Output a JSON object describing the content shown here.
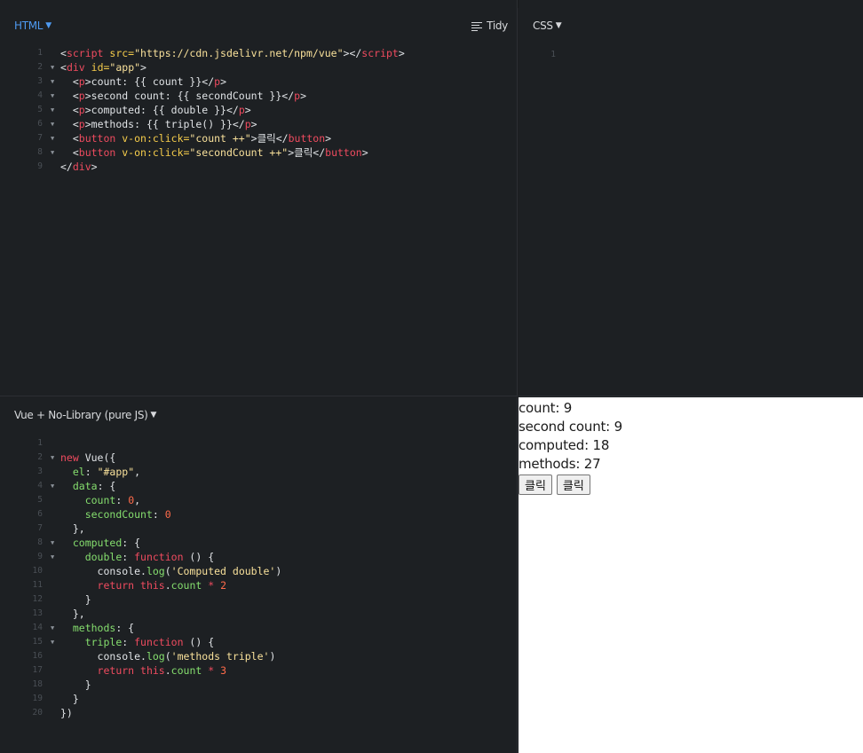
{
  "html_pane": {
    "language": "HTML",
    "tidy_label": "Tidy",
    "lines": [
      {
        "n": "1",
        "fold": false,
        "tokens": [
          {
            "c": "t-plain",
            "t": "<"
          },
          {
            "c": "t-tag",
            "t": "script"
          },
          {
            "c": "t-attr",
            "t": " src="
          },
          {
            "c": "t-str",
            "t": "\"https://cdn.jsdelivr.net/npm/vue\""
          },
          {
            "c": "t-plain",
            "t": "></"
          },
          {
            "c": "t-tag",
            "t": "script"
          },
          {
            "c": "t-plain",
            "t": ">"
          }
        ]
      },
      {
        "n": "2",
        "fold": true,
        "tokens": [
          {
            "c": "t-plain",
            "t": "<"
          },
          {
            "c": "t-tag",
            "t": "div"
          },
          {
            "c": "t-attr",
            "t": " id="
          },
          {
            "c": "t-str",
            "t": "\"app\""
          },
          {
            "c": "t-plain",
            "t": ">"
          }
        ]
      },
      {
        "n": "3",
        "fold": true,
        "tokens": [
          {
            "c": "t-plain",
            "t": "  <"
          },
          {
            "c": "t-tag",
            "t": "p"
          },
          {
            "c": "t-plain",
            "t": ">count: {{ count }}</"
          },
          {
            "c": "t-tag",
            "t": "p"
          },
          {
            "c": "t-plain",
            "t": ">"
          }
        ]
      },
      {
        "n": "4",
        "fold": true,
        "tokens": [
          {
            "c": "t-plain",
            "t": "  <"
          },
          {
            "c": "t-tag",
            "t": "p"
          },
          {
            "c": "t-plain",
            "t": ">second count: {{ secondCount }}</"
          },
          {
            "c": "t-tag",
            "t": "p"
          },
          {
            "c": "t-plain",
            "t": ">"
          }
        ]
      },
      {
        "n": "5",
        "fold": true,
        "tokens": [
          {
            "c": "t-plain",
            "t": "  <"
          },
          {
            "c": "t-tag",
            "t": "p"
          },
          {
            "c": "t-plain",
            "t": ">computed: {{ double }}</"
          },
          {
            "c": "t-tag",
            "t": "p"
          },
          {
            "c": "t-plain",
            "t": ">"
          }
        ]
      },
      {
        "n": "6",
        "fold": true,
        "tokens": [
          {
            "c": "t-plain",
            "t": "  <"
          },
          {
            "c": "t-tag",
            "t": "p"
          },
          {
            "c": "t-plain",
            "t": ">methods: {{ triple() }}</"
          },
          {
            "c": "t-tag",
            "t": "p"
          },
          {
            "c": "t-plain",
            "t": ">"
          }
        ]
      },
      {
        "n": "7",
        "fold": true,
        "tokens": [
          {
            "c": "t-plain",
            "t": "  <"
          },
          {
            "c": "t-tag",
            "t": "button"
          },
          {
            "c": "t-attr",
            "t": " v-on:click="
          },
          {
            "c": "t-str",
            "t": "\"count ++\""
          },
          {
            "c": "t-plain",
            "t": ">클릭</"
          },
          {
            "c": "t-tag",
            "t": "button"
          },
          {
            "c": "t-plain",
            "t": ">"
          }
        ]
      },
      {
        "n": "8",
        "fold": true,
        "tokens": [
          {
            "c": "t-plain",
            "t": "  <"
          },
          {
            "c": "t-tag",
            "t": "button"
          },
          {
            "c": "t-attr",
            "t": " v-on:click="
          },
          {
            "c": "t-str",
            "t": "\"secondCount ++\""
          },
          {
            "c": "t-plain",
            "t": ">클릭</"
          },
          {
            "c": "t-tag",
            "t": "button"
          },
          {
            "c": "t-plain",
            "t": ">"
          }
        ]
      },
      {
        "n": "9",
        "fold": false,
        "tokens": [
          {
            "c": "t-plain",
            "t": "</"
          },
          {
            "c": "t-tag",
            "t": "div"
          },
          {
            "c": "t-plain",
            "t": ">"
          }
        ]
      }
    ]
  },
  "css_pane": {
    "language": "CSS",
    "lines": [
      {
        "n": "1",
        "fold": false,
        "tokens": []
      }
    ]
  },
  "js_pane": {
    "language": "Vue + No-Library (pure JS)",
    "lines": [
      {
        "n": "1",
        "fold": false,
        "tokens": []
      },
      {
        "n": "2",
        "fold": true,
        "tokens": [
          {
            "c": "t-key",
            "t": "new"
          },
          {
            "c": "t-plain",
            "t": " Vue({"
          }
        ]
      },
      {
        "n": "3",
        "fold": false,
        "tokens": [
          {
            "c": "t-plain",
            "t": "  "
          },
          {
            "c": "t-prop",
            "t": "el"
          },
          {
            "c": "t-plain",
            "t": ": "
          },
          {
            "c": "t-str",
            "t": "\"#app\""
          },
          {
            "c": "t-plain",
            "t": ","
          }
        ]
      },
      {
        "n": "4",
        "fold": true,
        "tokens": [
          {
            "c": "t-plain",
            "t": "  "
          },
          {
            "c": "t-prop",
            "t": "data"
          },
          {
            "c": "t-plain",
            "t": ": {"
          }
        ]
      },
      {
        "n": "5",
        "fold": false,
        "tokens": [
          {
            "c": "t-plain",
            "t": "    "
          },
          {
            "c": "t-prop",
            "t": "count"
          },
          {
            "c": "t-plain",
            "t": ": "
          },
          {
            "c": "t-num",
            "t": "0"
          },
          {
            "c": "t-plain",
            "t": ","
          }
        ]
      },
      {
        "n": "6",
        "fold": false,
        "tokens": [
          {
            "c": "t-plain",
            "t": "    "
          },
          {
            "c": "t-prop",
            "t": "secondCount"
          },
          {
            "c": "t-plain",
            "t": ": "
          },
          {
            "c": "t-num",
            "t": "0"
          }
        ]
      },
      {
        "n": "7",
        "fold": false,
        "tokens": [
          {
            "c": "t-plain",
            "t": "  },"
          }
        ]
      },
      {
        "n": "8",
        "fold": true,
        "tokens": [
          {
            "c": "t-plain",
            "t": "  "
          },
          {
            "c": "t-prop",
            "t": "computed"
          },
          {
            "c": "t-plain",
            "t": ": {"
          }
        ]
      },
      {
        "n": "9",
        "fold": true,
        "tokens": [
          {
            "c": "t-plain",
            "t": "    "
          },
          {
            "c": "t-prop",
            "t": "double"
          },
          {
            "c": "t-plain",
            "t": ": "
          },
          {
            "c": "t-key",
            "t": "function"
          },
          {
            "c": "t-plain",
            "t": " () {"
          }
        ]
      },
      {
        "n": "10",
        "fold": false,
        "tokens": [
          {
            "c": "t-plain",
            "t": "      console."
          },
          {
            "c": "t-prop",
            "t": "log"
          },
          {
            "c": "t-plain",
            "t": "("
          },
          {
            "c": "t-str",
            "t": "'Computed double'"
          },
          {
            "c": "t-plain",
            "t": ")"
          }
        ]
      },
      {
        "n": "11",
        "fold": false,
        "tokens": [
          {
            "c": "t-plain",
            "t": "      "
          },
          {
            "c": "t-key",
            "t": "return"
          },
          {
            "c": "t-plain",
            "t": " "
          },
          {
            "c": "t-key",
            "t": "this"
          },
          {
            "c": "t-plain",
            "t": "."
          },
          {
            "c": "t-prop",
            "t": "count"
          },
          {
            "c": "t-plain",
            "t": " "
          },
          {
            "c": "t-key",
            "t": "*"
          },
          {
            "c": "t-plain",
            "t": " "
          },
          {
            "c": "t-num",
            "t": "2"
          }
        ]
      },
      {
        "n": "12",
        "fold": false,
        "tokens": [
          {
            "c": "t-plain",
            "t": "    }"
          }
        ]
      },
      {
        "n": "13",
        "fold": false,
        "tokens": [
          {
            "c": "t-plain",
            "t": "  },"
          }
        ]
      },
      {
        "n": "14",
        "fold": true,
        "tokens": [
          {
            "c": "t-plain",
            "t": "  "
          },
          {
            "c": "t-prop",
            "t": "methods"
          },
          {
            "c": "t-plain",
            "t": ": {"
          }
        ]
      },
      {
        "n": "15",
        "fold": true,
        "tokens": [
          {
            "c": "t-plain",
            "t": "    "
          },
          {
            "c": "t-prop",
            "t": "triple"
          },
          {
            "c": "t-plain",
            "t": ": "
          },
          {
            "c": "t-key",
            "t": "function"
          },
          {
            "c": "t-plain",
            "t": " () {"
          }
        ]
      },
      {
        "n": "16",
        "fold": false,
        "tokens": [
          {
            "c": "t-plain",
            "t": "      console."
          },
          {
            "c": "t-prop",
            "t": "log"
          },
          {
            "c": "t-plain",
            "t": "("
          },
          {
            "c": "t-str",
            "t": "'methods triple'"
          },
          {
            "c": "t-plain",
            "t": ")"
          }
        ]
      },
      {
        "n": "17",
        "fold": false,
        "tokens": [
          {
            "c": "t-plain",
            "t": "      "
          },
          {
            "c": "t-key",
            "t": "return"
          },
          {
            "c": "t-plain",
            "t": " "
          },
          {
            "c": "t-key",
            "t": "this"
          },
          {
            "c": "t-plain",
            "t": "."
          },
          {
            "c": "t-prop",
            "t": "count"
          },
          {
            "c": "t-plain",
            "t": " "
          },
          {
            "c": "t-key",
            "t": "*"
          },
          {
            "c": "t-plain",
            "t": " "
          },
          {
            "c": "t-num",
            "t": "3"
          }
        ]
      },
      {
        "n": "18",
        "fold": false,
        "tokens": [
          {
            "c": "t-plain",
            "t": "    }"
          }
        ]
      },
      {
        "n": "19",
        "fold": false,
        "tokens": [
          {
            "c": "t-plain",
            "t": "  }"
          }
        ]
      },
      {
        "n": "20",
        "fold": false,
        "tokens": [
          {
            "c": "t-plain",
            "t": "})"
          }
        ]
      }
    ]
  },
  "result": {
    "count_text": "count: 9",
    "second_count_text": "second count: 9",
    "computed_text": "computed: 18",
    "methods_text": "methods: 27",
    "button1_label": "클릭",
    "button2_label": "클릭"
  },
  "icons": {
    "caret": "caret-down-icon",
    "tidy": "tidy-lines-icon",
    "fold": "fold-triangle-icon"
  },
  "colors": {
    "accent": "#4e9af1",
    "editor_bg": "#1d2023",
    "tag": "#ef4b5f",
    "attr": "#f5cc4b",
    "string": "#f8e09a",
    "property": "#85de6e",
    "number": "#ff6b4a"
  }
}
